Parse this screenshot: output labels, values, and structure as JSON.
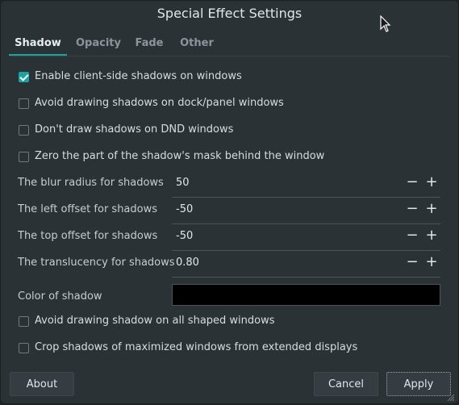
{
  "window": {
    "title": "Special Effect Settings"
  },
  "tabs": [
    {
      "label": "Shadow",
      "active": true
    },
    {
      "label": "Opacity",
      "active": false
    },
    {
      "label": "Fade",
      "active": false
    },
    {
      "label": "Other",
      "active": false
    }
  ],
  "checkboxes": [
    {
      "label": "Enable client-side shadows on windows",
      "checked": true
    },
    {
      "label": "Avoid drawing shadows on dock/panel windows",
      "checked": false
    },
    {
      "label": "Don't draw shadows on DND windows",
      "checked": false
    },
    {
      "label": "Zero the part of the shadow's mask behind the window",
      "checked": false
    }
  ],
  "spin_fields": [
    {
      "label": "The blur radius for shadows",
      "value": "50"
    },
    {
      "label": "The left offset for shadows",
      "value": "-50"
    },
    {
      "label": "The top offset for shadows",
      "value": "-50"
    },
    {
      "label": "The translucency for shadows",
      "value": "0.80"
    }
  ],
  "spin_buttons": {
    "decrement": "−",
    "increment": "+"
  },
  "color_field": {
    "label": "Color of shadow",
    "value": "#000000"
  },
  "bottom_checkboxes": [
    {
      "label": "Avoid drawing shadow on all shaped windows",
      "checked": false
    },
    {
      "label": "Crop shadows of maximized windows from extended displays",
      "checked": false
    }
  ],
  "footer": {
    "about": "About",
    "cancel": "Cancel",
    "apply": "Apply"
  },
  "colors": {
    "accent": "#1aa3a0",
    "background": "#2b3236"
  }
}
